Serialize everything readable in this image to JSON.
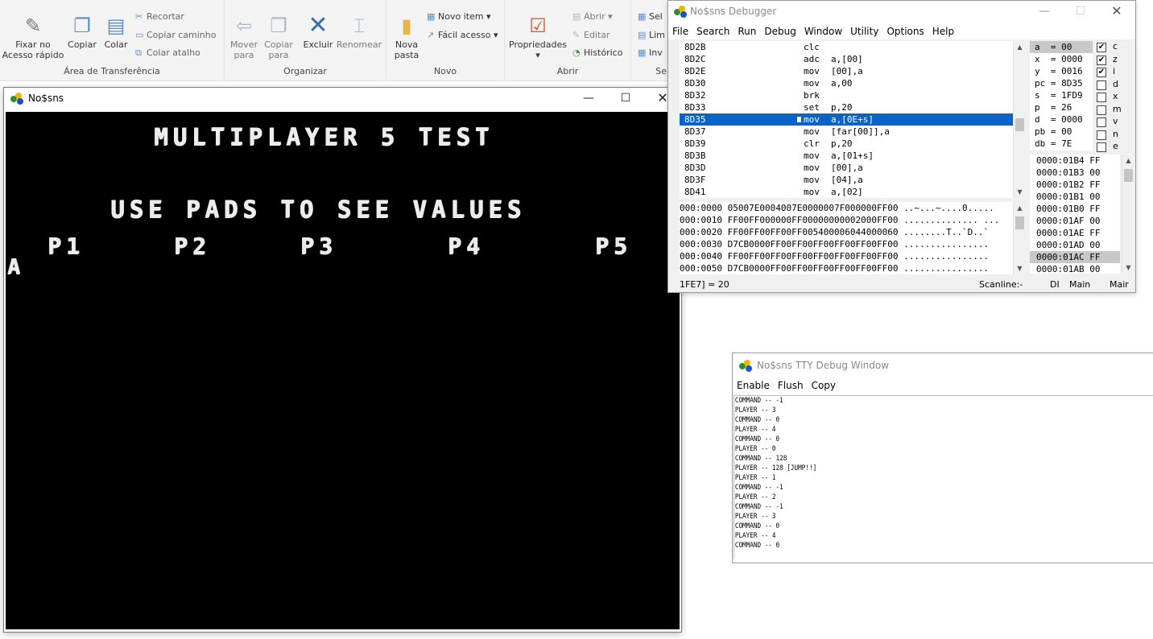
{
  "ribbon": {
    "groups": [
      {
        "label": "Área de Transferência"
      },
      {
        "label": "Organizar"
      },
      {
        "label": "Novo"
      },
      {
        "label": "Abrir"
      }
    ],
    "partial_group_label": "Se",
    "pin": "Fixar no Acesso rápido",
    "copy": "Copiar",
    "paste": "Colar",
    "cut": "Recortar",
    "copy_path": "Copiar caminho",
    "paste_shortcut": "Colar atalho",
    "move_to": "Mover para",
    "copy_to": "Copiar para",
    "delete": "Excluir",
    "rename": "Renomear",
    "new_folder": "Nova pasta",
    "new_item": "Novo item",
    "easy_access": "Fácil acesso",
    "properties": "Propriedades",
    "open": "Abrir",
    "edit": "Editar",
    "history": "Histórico",
    "select_partial": [
      "Sel",
      "Lim",
      "Inv"
    ]
  },
  "emulator": {
    "title": "No$sns",
    "screen": {
      "heading": "MULTIPLAYER 5 TEST",
      "subheading": "USE PADS TO SEE VALUES",
      "players": [
        "P1",
        "P2",
        "P3",
        "P4",
        "P5"
      ],
      "corner_glyph": "A"
    }
  },
  "debugger": {
    "title": "No$sns Debugger",
    "menu": [
      "File",
      "Search",
      "Run",
      "Debug",
      "Window",
      "Utility",
      "Options",
      "Help"
    ],
    "disassembly": [
      {
        "addr": "8D2B",
        "mn": "clc",
        "op": ""
      },
      {
        "addr": "8D2C",
        "mn": "adc",
        "op": "a,[00]"
      },
      {
        "addr": "8D2E",
        "mn": "mov",
        "op": "[00],a"
      },
      {
        "addr": "8D30",
        "mn": "mov",
        "op": "a,00"
      },
      {
        "addr": "8D32",
        "mn": "brk",
        "op": ""
      },
      {
        "addr": "8D33",
        "mn": "set",
        "op": "p,20"
      },
      {
        "addr": "8D35",
        "mn": "mov",
        "op": "a,[0E+s]"
      },
      {
        "addr": "8D37",
        "mn": "mov",
        "op": "[far[00]],a"
      },
      {
        "addr": "8D39",
        "mn": "clr",
        "op": "p,20"
      },
      {
        "addr": "8D3B",
        "mn": "mov",
        "op": "a,[01+s]"
      },
      {
        "addr": "8D3D",
        "mn": "mov",
        "op": "[00],a"
      },
      {
        "addr": "8D3F",
        "mn": "mov",
        "op": "[04],a"
      },
      {
        "addr": "8D41",
        "mn": "mov",
        "op": "a,[02]"
      }
    ],
    "selected_line": 6,
    "registers": [
      "a  = 00",
      "x  = 0000",
      "y  = 0016",
      "pc = 8D35",
      "s  = 1FD9",
      "p  = 26",
      "d  = 0000",
      "pb = 00",
      "db = 7E"
    ],
    "flags": [
      {
        "name": "c",
        "checked": true
      },
      {
        "name": "z",
        "checked": true
      },
      {
        "name": "i",
        "checked": true
      },
      {
        "name": "d",
        "checked": false
      },
      {
        "name": "x",
        "checked": false
      },
      {
        "name": "m",
        "checked": false
      },
      {
        "name": "v",
        "checked": false
      },
      {
        "name": "n",
        "checked": false
      },
      {
        "name": "e",
        "checked": false
      }
    ],
    "stack": [
      "0000:01B4 FF",
      "0000:01B3 00",
      "0000:01B2 FF",
      "0000:01B1 00",
      "0000:01B0 FF",
      "0000:01AF 00",
      "0000:01AE FF",
      "0000:01AD 00",
      "0000:01AC FF",
      "0000:01AB 00"
    ],
    "stack_selected": 8,
    "hexdump": [
      "000:0000 05007E0004007E0000007F000000FF00 ..~...~....0.....",
      "000:0010 FF00FF000000FF00000000002000FF00 .............. ...",
      "000:0020 FF00FF00FF00FF005400006044000060 ........T..`D..`",
      "000:0030 D7CB0000FF00FF00FF00FF00FF00FF00 ................",
      "000:0040 FF00FF00FF00FF00FF00FF00FF00FF00 ................",
      "000:0050 D7CB0000FF00FF00FF00FF00FF00FF00 ................"
    ],
    "status": {
      "left": "1FE7] = 20",
      "scanline": "Scanline:-",
      "flag": "DI",
      "mode1": "Main",
      "mode2": "Mair"
    }
  },
  "tty": {
    "title": "No$sns TTY Debug Window",
    "menu": [
      "Enable",
      "Flush",
      "Copy"
    ],
    "lines": [
      "COMMAND -- -1",
      "PLAYER -- 3",
      "COMMAND -- 0",
      "PLAYER -- 4",
      "COMMAND -- 0",
      "PLAYER -- 0",
      "COMMAND -- 128",
      "PLAYER -- 128 [JUMP!!]",
      "PLAYER -- 1",
      "COMMAND -- -1",
      "PLAYER -- 2",
      "COMMAND -- -1",
      "PLAYER -- 3",
      "COMMAND -- 0",
      "PLAYER -- 4",
      "COMMAND -- 0"
    ]
  },
  "colors": {
    "selection": "#0a64c8",
    "emulator_bg": "#000000",
    "ribbon_bg": "#f3f3f3"
  }
}
